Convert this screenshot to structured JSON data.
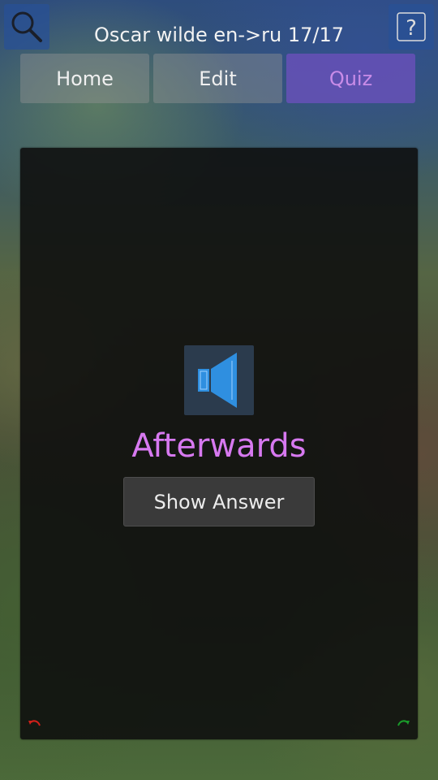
{
  "header": {
    "title": "Oscar wilde en->ru 17/17",
    "search_icon": "search-icon",
    "help_icon": "help-icon",
    "help_glyph": "?"
  },
  "tabs": [
    {
      "label": "Home",
      "selected": false
    },
    {
      "label": "Edit",
      "selected": false
    },
    {
      "label": "Quiz",
      "selected": true
    }
  ],
  "card": {
    "speaker_icon": "speaker-icon",
    "word": "Afterwards",
    "show_answer_label": "Show Answer",
    "left_corner_icon": "undo-arrow-icon",
    "right_corner_icon": "redo-arrow-icon"
  },
  "colors": {
    "accent_quiz_bg": "#6950b9",
    "accent_quiz_text": "#c98ce8",
    "word_color": "#d779f0",
    "speaker_blue": "#2f8fe0",
    "undo_red": "#d0201a",
    "redo_green": "#1a9a2a"
  }
}
